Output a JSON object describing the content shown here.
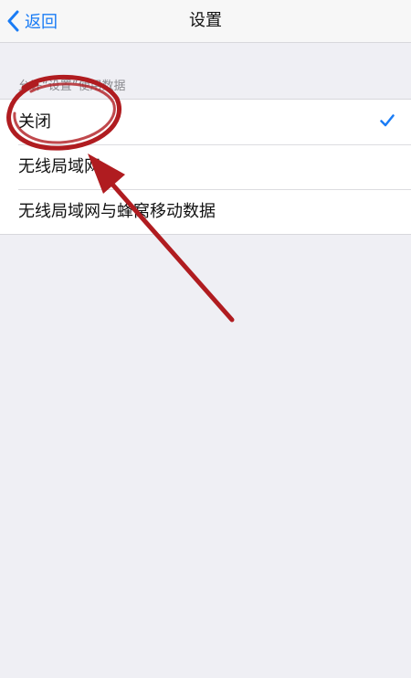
{
  "navbar": {
    "back_label": "返回",
    "title": "设置"
  },
  "section": {
    "header": "允许“设置”使用数据"
  },
  "options": [
    {
      "label": "关闭",
      "selected": true
    },
    {
      "label": "无线局域网",
      "selected": false
    },
    {
      "label": "无线局域网与蜂窝移动数据",
      "selected": false
    }
  ],
  "colors": {
    "accent": "#1a7cf5",
    "annotation": "#b01c20",
    "background": "#efeff4"
  },
  "icons": {
    "back": "chevron-left-icon",
    "selected": "checkmark-icon"
  }
}
